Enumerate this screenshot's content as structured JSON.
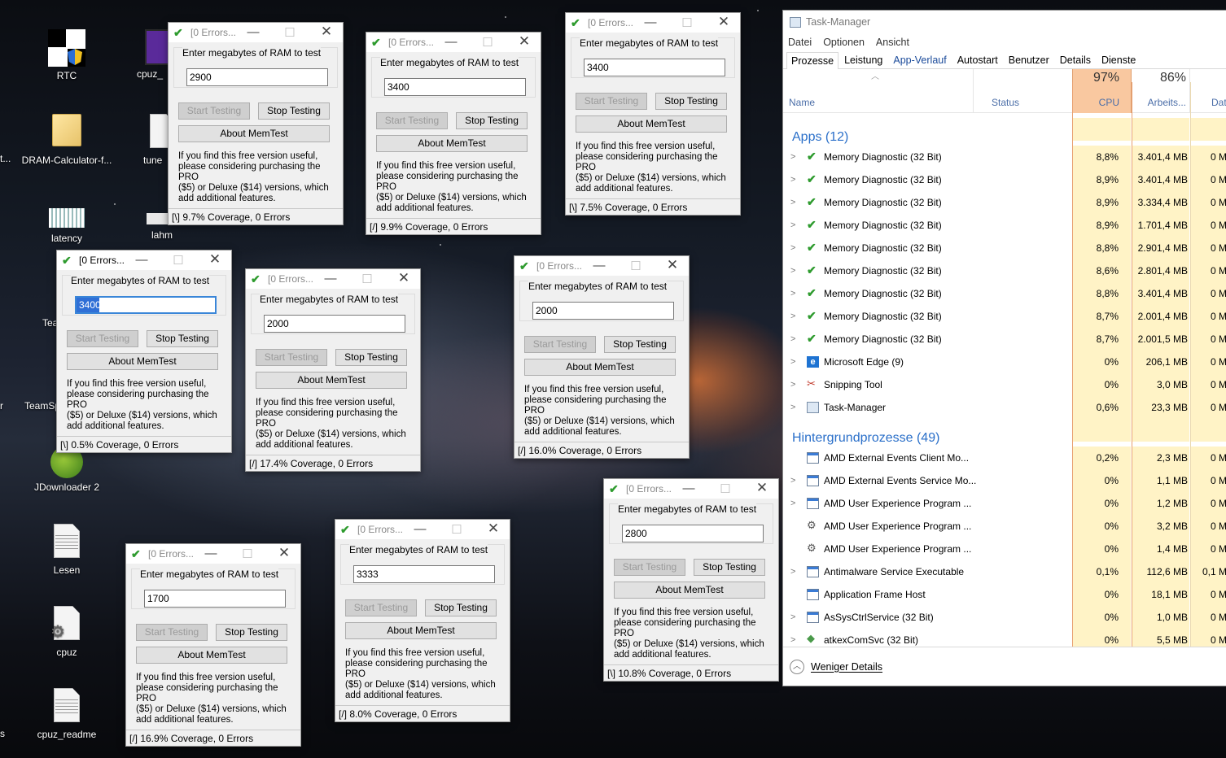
{
  "desktop": {
    "icons": [
      {
        "label": "RTC"
      },
      {
        "label": "cpuz_"
      },
      {
        "label": "DRAM-Calculator-f..."
      },
      {
        "label": "tune"
      },
      {
        "label": "latency"
      },
      {
        "label": "lahm"
      },
      {
        "label": "Tea"
      },
      {
        "label": "TeamSp"
      },
      {
        "label": "JDownloader 2"
      },
      {
        "label": "Lesen"
      },
      {
        "label": "cpuz"
      },
      {
        "label": "cpuz_readme"
      },
      {
        "label": "t..."
      },
      {
        "label": "r"
      },
      {
        "label": "s"
      }
    ]
  },
  "memtest": {
    "title": "[0 Errors...",
    "label": "Enter megabytes of RAM to test",
    "start_label": "Start Testing",
    "stop_label": "Stop Testing",
    "about_label": "About MemTest",
    "info_lines": [
      "If you find this free version useful,",
      "please considering purchasing the PRO",
      "($5) or Deluxe ($14) versions, which",
      "add additional features."
    ],
    "windows": [
      {
        "value": "2900",
        "status": "[\\]  9.7% Coverage, 0 Errors"
      },
      {
        "value": "3400",
        "status": "[/]  9.9% Coverage, 0 Errors"
      },
      {
        "value": "3400",
        "status": "[\\]  7.5% Coverage, 0 Errors"
      },
      {
        "value": "3400",
        "status": "[\\]  0.5% Coverage, 0 Errors"
      },
      {
        "value": "2000",
        "status": "[/]  17.4% Coverage, 0 Errors"
      },
      {
        "value": "2000",
        "status": "[/]  16.0% Coverage, 0 Errors"
      },
      {
        "value": "2800",
        "status": "[\\]  10.8% Coverage, 0 Errors"
      },
      {
        "value": "3333",
        "status": "[/]  8.0% Coverage, 0 Errors"
      },
      {
        "value": "1700",
        "status": "[/]  16.9% Coverage, 0 Errors"
      }
    ]
  },
  "taskmanager": {
    "title": "Task-Manager",
    "menu": [
      "Datei",
      "Optionen",
      "Ansicht"
    ],
    "tabs": [
      "Prozesse",
      "Leistung",
      "App-Verlauf",
      "Autostart",
      "Benutzer",
      "Details",
      "Dienste"
    ],
    "columns": {
      "name": "Name",
      "status": "Status",
      "cpu_pct": "97%",
      "cpu": "CPU",
      "mem_pct": "86%",
      "mem": "Arbeits...",
      "disk": "Datent"
    },
    "apps_header": "Apps (12)",
    "apps": [
      {
        "name": "Memory Diagnostic (32 Bit)",
        "cpu": "8,8%",
        "mem": "3.401,4 MB",
        "disk": "0 M"
      },
      {
        "name": "Memory Diagnostic (32 Bit)",
        "cpu": "8,9%",
        "mem": "3.401,4 MB",
        "disk": "0 M"
      },
      {
        "name": "Memory Diagnostic (32 Bit)",
        "cpu": "8,9%",
        "mem": "3.334,4 MB",
        "disk": "0 M"
      },
      {
        "name": "Memory Diagnostic (32 Bit)",
        "cpu": "8,9%",
        "mem": "1.701,4 MB",
        "disk": "0 M"
      },
      {
        "name": "Memory Diagnostic (32 Bit)",
        "cpu": "8,8%",
        "mem": "2.901,4 MB",
        "disk": "0 M"
      },
      {
        "name": "Memory Diagnostic (32 Bit)",
        "cpu": "8,6%",
        "mem": "2.801,4 MB",
        "disk": "0 M"
      },
      {
        "name": "Memory Diagnostic (32 Bit)",
        "cpu": "8,8%",
        "mem": "3.401,4 MB",
        "disk": "0 M"
      },
      {
        "name": "Memory Diagnostic (32 Bit)",
        "cpu": "8,7%",
        "mem": "2.001,4 MB",
        "disk": "0 M"
      },
      {
        "name": "Memory Diagnostic (32 Bit)",
        "cpu": "8,7%",
        "mem": "2.001,5 MB",
        "disk": "0 M"
      },
      {
        "name": "Microsoft Edge (9)",
        "cpu": "0%",
        "mem": "206,1 MB",
        "disk": "0 M"
      },
      {
        "name": "Snipping Tool",
        "cpu": "0%",
        "mem": "3,0 MB",
        "disk": "0 M"
      },
      {
        "name": "Task-Manager",
        "cpu": "0,6%",
        "mem": "23,3 MB",
        "disk": "0 M"
      }
    ],
    "bg_header": "Hintergrundprozesse (49)",
    "bg": [
      {
        "name": "AMD External Events Client Mo...",
        "cpu": "0,2%",
        "mem": "2,3 MB",
        "disk": "0 M"
      },
      {
        "name": "AMD External Events Service Mo...",
        "cpu": "0%",
        "mem": "1,1 MB",
        "disk": "0 M"
      },
      {
        "name": "AMD User Experience Program ...",
        "cpu": "0%",
        "mem": "1,2 MB",
        "disk": "0 M"
      },
      {
        "name": "AMD User Experience Program ...",
        "cpu": "0%",
        "mem": "3,2 MB",
        "disk": "0 M"
      },
      {
        "name": "AMD User Experience Program ...",
        "cpu": "0%",
        "mem": "1,4 MB",
        "disk": "0 M"
      },
      {
        "name": "Antimalware Service Executable",
        "cpu": "0,1%",
        "mem": "112,6 MB",
        "disk": "0,1 M"
      },
      {
        "name": "Application Frame Host",
        "cpu": "0%",
        "mem": "18,1 MB",
        "disk": "0 M"
      },
      {
        "name": "AsSysCtrlService (32 Bit)",
        "cpu": "0%",
        "mem": "1,0 MB",
        "disk": "0 M"
      },
      {
        "name": "atkexComSvc (32 Bit)",
        "cpu": "0%",
        "mem": "5,5 MB",
        "disk": "0 M"
      }
    ],
    "footer": "Weniger Details"
  }
}
